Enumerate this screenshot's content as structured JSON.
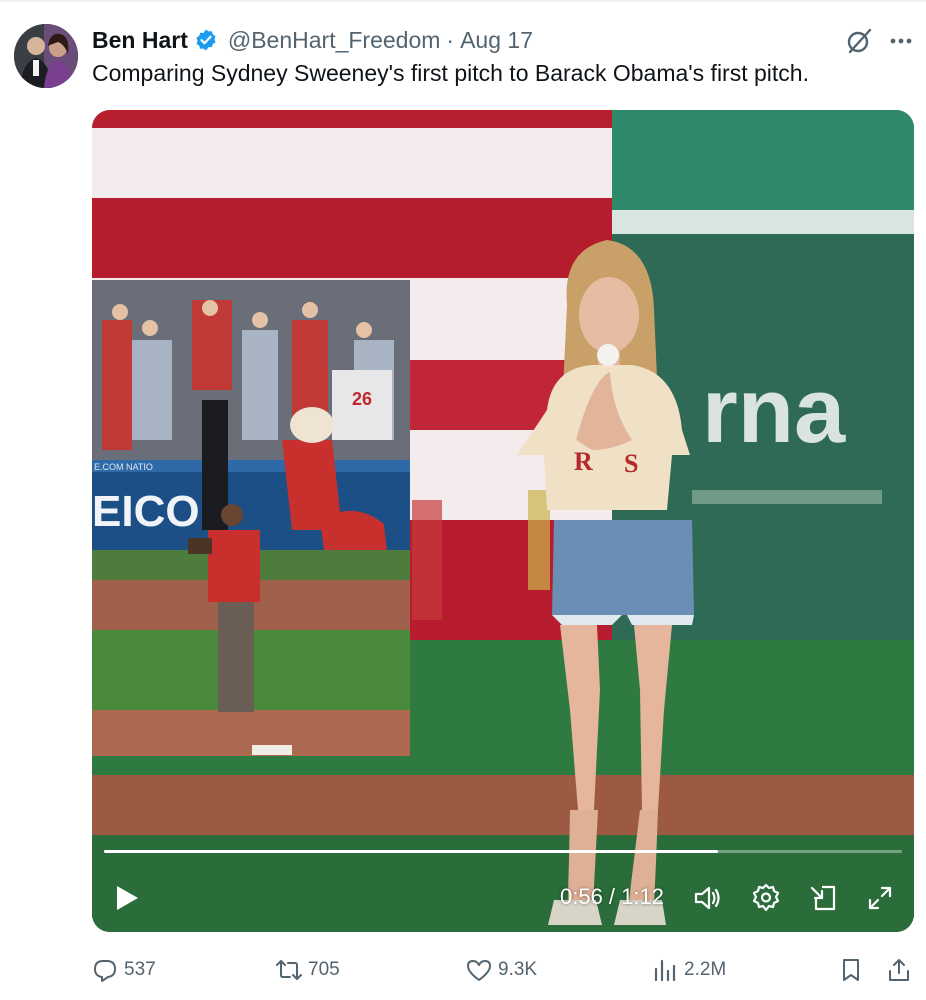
{
  "tweet": {
    "author_name": "Ben Hart",
    "handle": "@BenHart_Freedom",
    "separator": "·",
    "date": "Aug 17",
    "text": "Comparing Sydney Sweeney's first pitch to Barack Obama's first pitch."
  },
  "video": {
    "time_display": "0:56 / 1:12",
    "progress": 0.77,
    "banner_text": "rna",
    "jersey_number": "26",
    "wall_text": "EICO",
    "wall_small_text": "E.COM   NATIO"
  },
  "actions": {
    "replies": "537",
    "reposts": "705",
    "likes": "9.3K",
    "views": "2.2M"
  },
  "colors": {
    "verified_blue": "#1d9bf0",
    "muted_text": "#536471"
  },
  "icons": [
    "verified-badge-icon",
    "grok-icon",
    "more-icon",
    "play-icon",
    "volume-icon",
    "settings-icon",
    "pip-icon",
    "fullscreen-icon",
    "reply-icon",
    "repost-icon",
    "like-icon",
    "views-icon",
    "bookmark-icon",
    "share-icon"
  ]
}
